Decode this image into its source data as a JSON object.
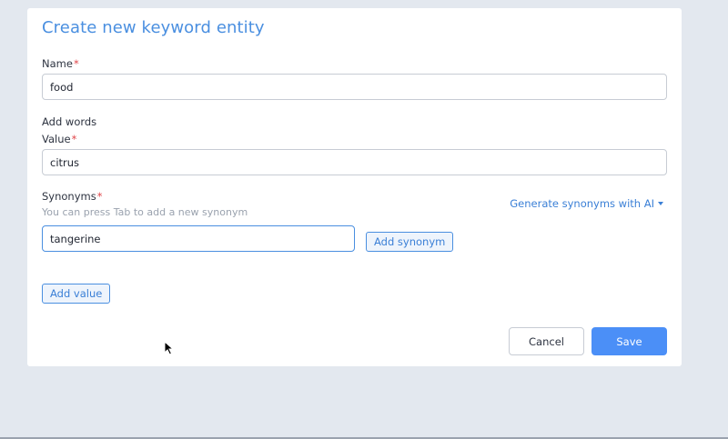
{
  "modal": {
    "title": "Create new keyword entity"
  },
  "name_field": {
    "label": "Name",
    "required_mark": "*",
    "value": "food"
  },
  "add_words": {
    "heading": "Add words"
  },
  "value_field": {
    "label": "Value",
    "required_mark": "*",
    "value": "citrus"
  },
  "synonyms_field": {
    "label": "Synonyms",
    "required_mark": "*",
    "hint": "You can press Tab to add a new synonym",
    "value": "tangerine",
    "add_synonym_label": "Add synonym",
    "generate_ai_label": "Generate synonyms with AI"
  },
  "actions": {
    "add_value_label": "Add value",
    "cancel_label": "Cancel",
    "save_label": "Save"
  },
  "colors": {
    "accent": "#4a8fe0",
    "primary_button": "#4b8ff7",
    "required": "#e0464a",
    "background": "#e3e8ef"
  }
}
